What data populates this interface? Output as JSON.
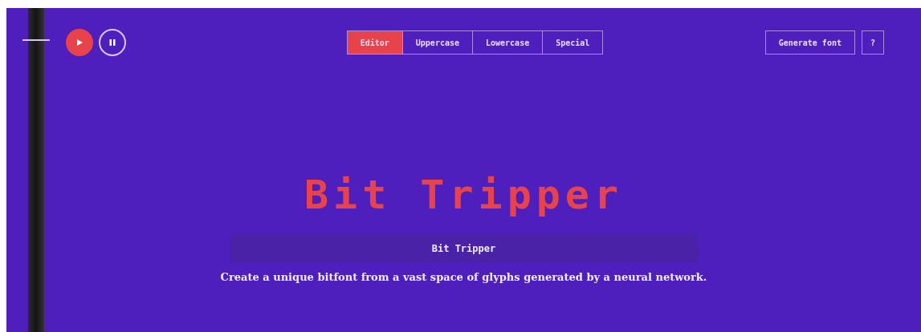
{
  "player": {
    "playing": true
  },
  "tabs": [
    {
      "label": "Editor",
      "selected": true
    },
    {
      "label": "Uppercase",
      "selected": false
    },
    {
      "label": "Lowercase",
      "selected": false
    },
    {
      "label": "Special",
      "selected": false
    }
  ],
  "actions": [
    "Generate font",
    "?"
  ],
  "preview": "Bit Tripper",
  "name_field": {
    "value": "Bit Tripper"
  },
  "tagline": "Create a unique bitfont from a vast space of glyphs generated by a neural network."
}
